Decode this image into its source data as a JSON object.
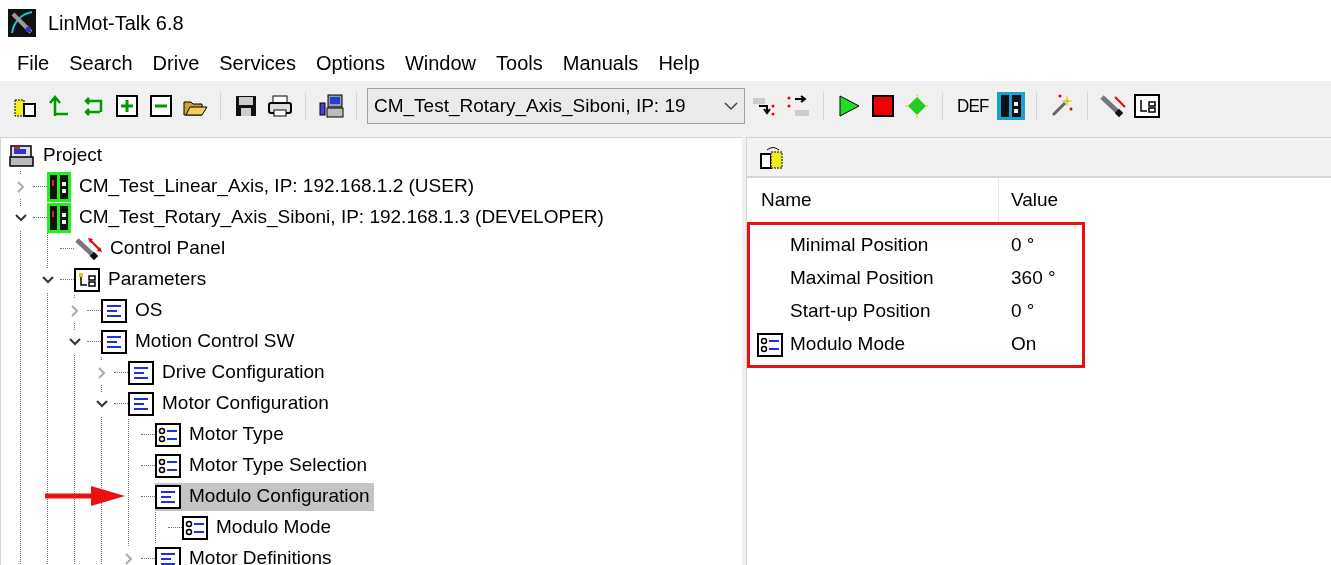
{
  "window": {
    "title": "LinMot-Talk 6.8"
  },
  "menu": [
    "File",
    "Search",
    "Drive",
    "Services",
    "Options",
    "Window",
    "Tools",
    "Manuals",
    "Help"
  ],
  "toolbar": {
    "drive_select": "CM_Test_Rotary_Axis_Siboni, IP: 19",
    "def_label": "DEF"
  },
  "tree": [
    {
      "label": "Project",
      "kind": "project",
      "selected": false,
      "children": [
        {
          "label": "CM_Test_Linear_Axis, IP: 192.168.1.2 (USER)",
          "kind": "drive",
          "expanded": false,
          "selected": false
        },
        {
          "label": "CM_Test_Rotary_Axis_Siboni, IP: 192.168.1.3 (DEVELOPER)",
          "kind": "drive",
          "expanded": true,
          "selected": false,
          "children": [
            {
              "label": "Control Panel",
              "kind": "control",
              "selected": false
            },
            {
              "label": "Parameters",
              "kind": "parameters",
              "expanded": true,
              "selected": false,
              "children": [
                {
                  "label": "OS",
                  "kind": "folder",
                  "expanded": false,
                  "selected": false
                },
                {
                  "label": "Motion Control SW",
                  "kind": "folder",
                  "expanded": true,
                  "selected": false,
                  "children": [
                    {
                      "label": "Drive Configuration",
                      "kind": "folder",
                      "expanded": false,
                      "selected": false
                    },
                    {
                      "label": "Motor Configuration",
                      "kind": "folder",
                      "expanded": true,
                      "selected": false,
                      "children": [
                        {
                          "label": "Motor Type",
                          "kind": "param",
                          "selected": false
                        },
                        {
                          "label": "Motor Type Selection",
                          "kind": "param",
                          "selected": false
                        },
                        {
                          "label": "Modulo Configuration",
                          "kind": "folder",
                          "selected": true,
                          "pointed": true,
                          "children": [
                            {
                              "label": "Modulo Mode",
                              "kind": "param",
                              "selected": false
                            }
                          ]
                        },
                        {
                          "label": "Motor Definitions",
                          "kind": "folder",
                          "expanded": false,
                          "selected": false
                        }
                      ]
                    }
                  ]
                }
              ]
            }
          ]
        }
      ]
    }
  ],
  "properties": {
    "columns": [
      "Name",
      "Value"
    ],
    "highlighted": true,
    "rows": [
      {
        "name": "Minimal Position",
        "value": "0 °",
        "kind": "value"
      },
      {
        "name": "Maximal Position",
        "value": "360 °",
        "kind": "value"
      },
      {
        "name": "Start-up Position",
        "value": "0 °",
        "kind": "value"
      },
      {
        "name": "Modulo Mode",
        "value": "On",
        "kind": "param"
      }
    ]
  }
}
